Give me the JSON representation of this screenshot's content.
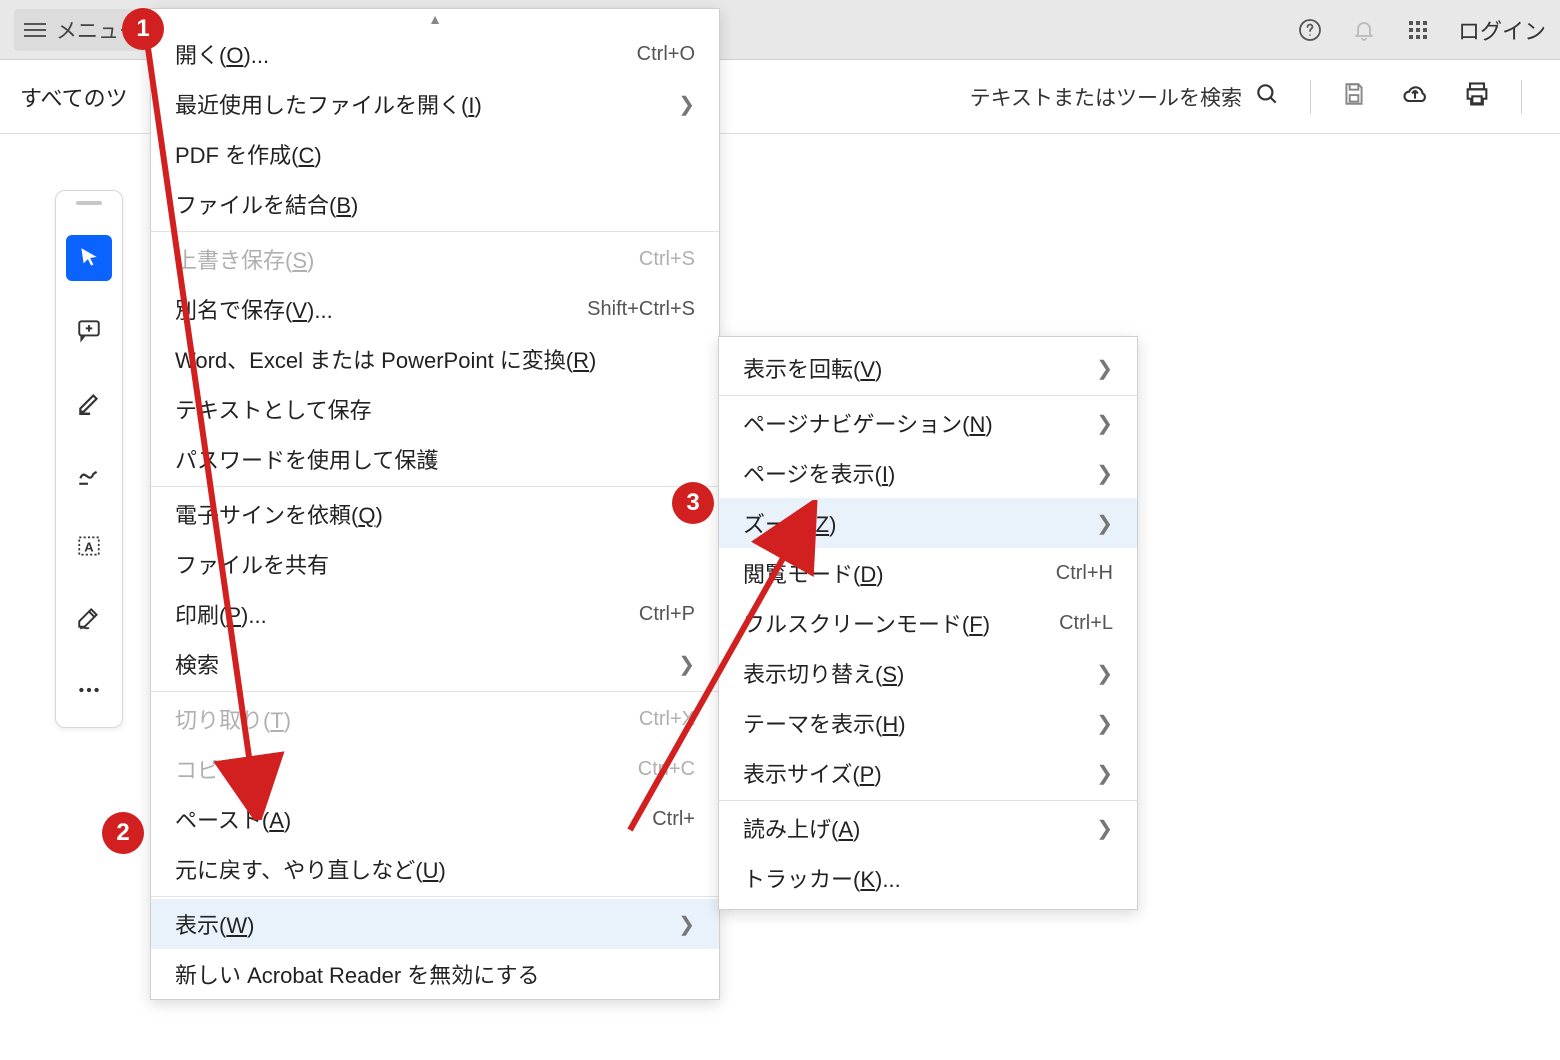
{
  "topbar": {
    "menu_label": "メニュー",
    "login_label": "ログイン"
  },
  "secondbar": {
    "all_tools": "すべてのツ",
    "search_placeholder": "テキストまたはツールを検索"
  },
  "menu": {
    "items": [
      {
        "label": "開く(O)...",
        "accel": "Ctrl+O"
      },
      {
        "label": "最近使用したファイルを開く(I)",
        "sub": true
      },
      {
        "label": "PDF を作成(C)"
      },
      {
        "label": "ファイルを結合(B)"
      },
      {
        "sep": true
      },
      {
        "label": "上書き保存(S)",
        "accel": "Ctrl+S",
        "disabled": true
      },
      {
        "label": "別名で保存(V)...",
        "accel": "Shift+Ctrl+S"
      },
      {
        "label": "Word、Excel または PowerPoint に変換(R)"
      },
      {
        "label": "テキストとして保存"
      },
      {
        "label": "パスワードを使用して保護"
      },
      {
        "sep": true
      },
      {
        "label": "電子サインを依頼(Q)"
      },
      {
        "label": "ファイルを共有"
      },
      {
        "label": "印刷(P)...",
        "accel": "Ctrl+P"
      },
      {
        "label": "検索",
        "sub": true
      },
      {
        "sep": true
      },
      {
        "label": "切り取り(T)",
        "accel": "Ctrl+X",
        "disabled": true
      },
      {
        "label": "コピー",
        "accel": "Ctrl+C",
        "disabled": true
      },
      {
        "label": "ペースト(A)",
        "accel": "Ctrl+"
      },
      {
        "label": "元に戻す、やり直しなど(U)"
      },
      {
        "sep": true
      },
      {
        "label": "表示(W)",
        "sub": true,
        "hover": true
      },
      {
        "label": "新しい Acrobat Reader を無効にする"
      }
    ]
  },
  "submenu": {
    "items": [
      {
        "label": "表示を回転(V)",
        "sub": true
      },
      {
        "sep": true
      },
      {
        "label": "ページナビゲーション(N)",
        "sub": true
      },
      {
        "label": "ページを表示(I)",
        "sub": true
      },
      {
        "label": "ズーム(Z)",
        "sub": true,
        "hover": true
      },
      {
        "label": "閲覧モード(D)",
        "accel": "Ctrl+H"
      },
      {
        "label": "フルスクリーンモード(F)",
        "accel": "Ctrl+L"
      },
      {
        "label": "表示切り替え(S)",
        "sub": true
      },
      {
        "label": "テーマを表示(H)",
        "sub": true
      },
      {
        "label": "表示サイズ(P)",
        "sub": true
      },
      {
        "sep": true
      },
      {
        "label": "読み上げ(A)",
        "sub": true
      },
      {
        "label": "トラッカー(K)..."
      }
    ]
  },
  "annotations": {
    "b1": "1",
    "b2": "2",
    "b3": "3"
  }
}
